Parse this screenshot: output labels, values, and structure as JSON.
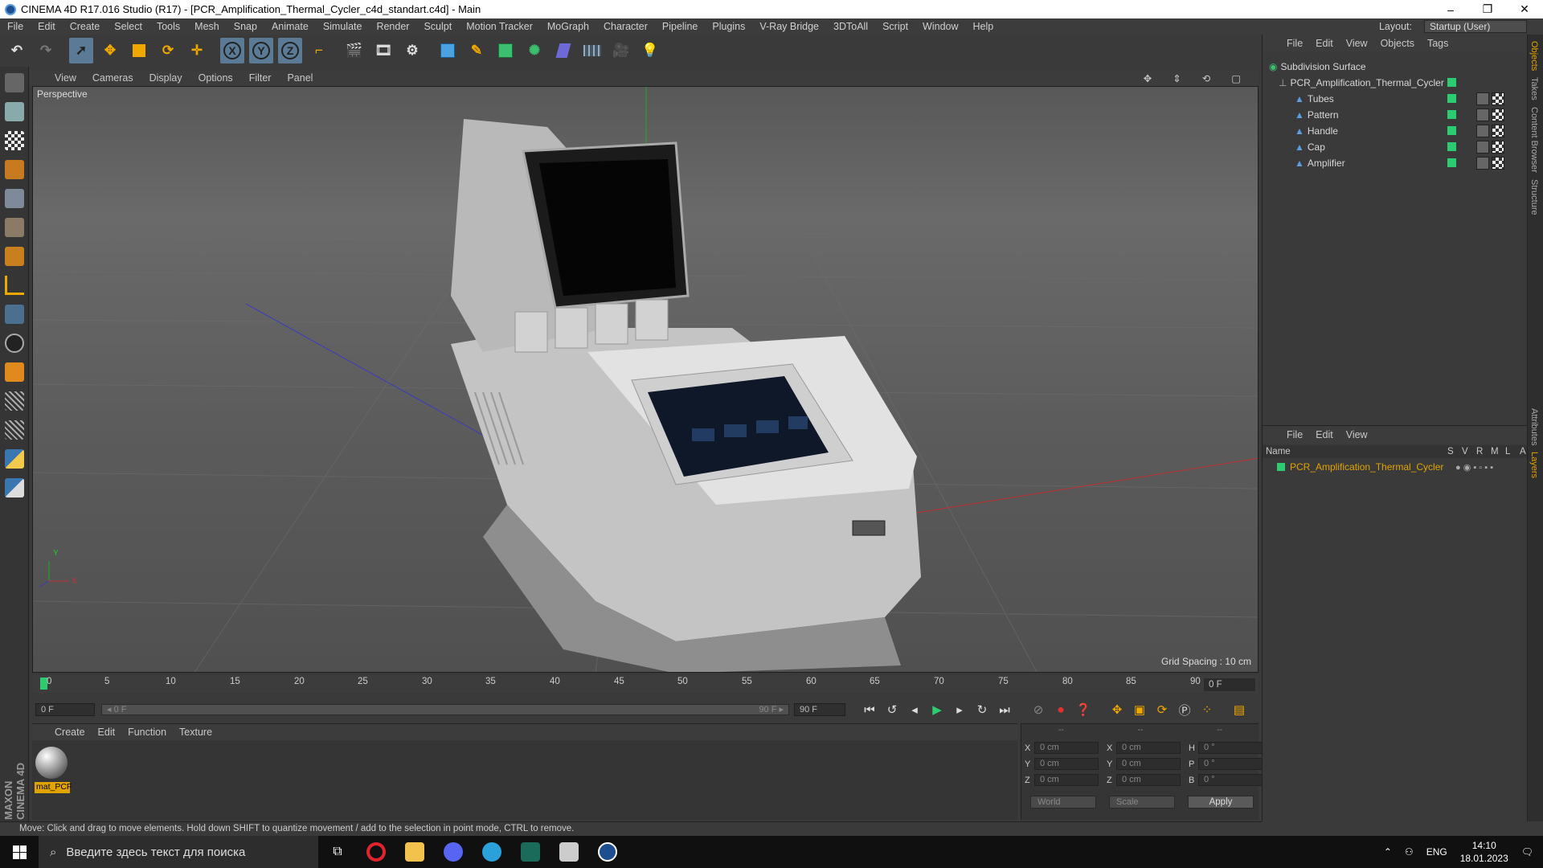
{
  "window": {
    "title": "CINEMA 4D R17.016 Studio (R17) - [PCR_Amplification_Thermal_Cycler_c4d_standart.c4d] - Main",
    "controls": [
      "–",
      "❐",
      "✕"
    ]
  },
  "menubar": {
    "items": [
      "File",
      "Edit",
      "Create",
      "Select",
      "Tools",
      "Mesh",
      "Snap",
      "Animate",
      "Simulate",
      "Render",
      "Sculpt",
      "Motion Tracker",
      "MoGraph",
      "Character",
      "Pipeline",
      "Plugins",
      "V-Ray Bridge",
      "3DToAll",
      "Script",
      "Window",
      "Help"
    ],
    "layout_label": "Layout:",
    "layout_value": "Startup (User)"
  },
  "toolbar": {
    "icons": [
      "undo-icon",
      "redo-icon",
      "select-icon",
      "move-icon",
      "scale-icon",
      "rotate-icon",
      "live-select-icon",
      "x-axis-icon",
      "y-axis-icon",
      "z-axis-icon",
      "coordinate-system-icon",
      "render-view-icon",
      "render-picture-viewer-icon",
      "render-settings-icon",
      "cube-icon",
      "pen-icon",
      "subdivision-icon",
      "array-icon",
      "deformer-icon",
      "floor-icon",
      "camera-icon",
      "light-icon"
    ],
    "axis_labels": [
      "X",
      "Y",
      "Z"
    ]
  },
  "viewport": {
    "menu": [
      "View",
      "Cameras",
      "Display",
      "Options",
      "Filter",
      "Panel"
    ],
    "label": "Perspective",
    "grid_spacing": "Grid Spacing : 10 cm",
    "axis_y": "Y",
    "axis_x": "X"
  },
  "timeline": {
    "ticks": [
      "0",
      "5",
      "10",
      "15",
      "20",
      "25",
      "30",
      "35",
      "40",
      "45",
      "50",
      "55",
      "60",
      "65",
      "70",
      "75",
      "80",
      "85",
      "90"
    ],
    "current_frame": "0 F",
    "start_field": "0 F",
    "range_start": "◂ 0 F",
    "range_end": "90 F ▸",
    "end_field": "90 F"
  },
  "material_panel": {
    "menu": [
      "Create",
      "Edit",
      "Function",
      "Texture"
    ],
    "material_name": "mat_PCF"
  },
  "brand": "MAXON CINEMA 4D",
  "coords": {
    "headers": [
      "--",
      "--",
      "--"
    ],
    "rows": [
      {
        "l1": "X",
        "v1": "0 cm",
        "l2": "X",
        "v2": "0 cm",
        "l3": "H",
        "v3": "0 °"
      },
      {
        "l1": "Y",
        "v1": "0 cm",
        "l2": "Y",
        "v2": "0 cm",
        "l3": "P",
        "v3": "0 °"
      },
      {
        "l1": "Z",
        "v1": "0 cm",
        "l2": "Z",
        "v2": "0 cm",
        "l3": "B",
        "v3": "0 °"
      }
    ],
    "world": "World",
    "scale": "Scale",
    "apply": "Apply"
  },
  "status_text": "Move: Click and drag to move elements. Hold down SHIFT to quantize movement / add to the selection in point mode, CTRL to remove.",
  "object_manager": {
    "menu": [
      "File",
      "Edit",
      "View",
      "Objects",
      "Tags"
    ],
    "objects": [
      {
        "name": "Subdivision Surface"
      },
      {
        "name": "PCR_Amplification_Thermal_Cycler"
      },
      {
        "name": "Tubes"
      },
      {
        "name": "Pattern"
      },
      {
        "name": "Handle"
      },
      {
        "name": "Cap"
      },
      {
        "name": "Amplifier"
      }
    ]
  },
  "layer_manager": {
    "menu": [
      "File",
      "Edit",
      "View"
    ],
    "columns": [
      "Name",
      "S",
      "V",
      "R",
      "M",
      "L",
      "A"
    ],
    "layer_name": "PCR_Amplification_Thermal_Cycler"
  },
  "right_tabs": [
    "Objects",
    "Takes",
    "Content Browser",
    "Structure",
    "Attributes",
    "Layers"
  ],
  "taskbar": {
    "search_placeholder": "Введите здесь текст для поиска",
    "lang": "ENG",
    "time": "14:10",
    "date": "18.01.2023"
  },
  "colors": {
    "accent_orange": "#e0a300",
    "layer_green": "#2ecc71"
  }
}
